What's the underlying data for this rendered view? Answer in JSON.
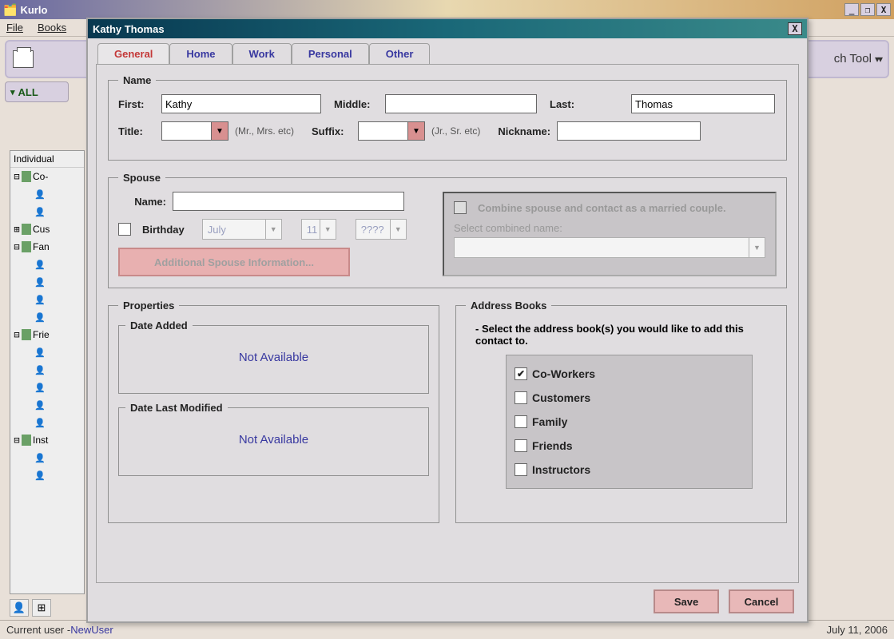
{
  "app": {
    "title": "Kurlo",
    "menu": {
      "file": "File",
      "books": "Books"
    },
    "toolbarRight": "ch Tool",
    "allFilter": "ALL",
    "treeHeader": "Individual",
    "treeGroups": [
      "Co-",
      "Cus",
      "Fan",
      "Frie",
      "Inst"
    ]
  },
  "status": {
    "label": "Current user - ",
    "user": "NewUser",
    "date": "July 11, 2006"
  },
  "dialog": {
    "title": "Kathy Thomas",
    "tabs": {
      "general": "General",
      "home": "Home",
      "work": "Work",
      "personal": "Personal",
      "other": "Other"
    },
    "name": {
      "legend": "Name",
      "firstLbl": "First:",
      "first": "Kathy",
      "middleLbl": "Middle:",
      "middle": "",
      "lastLbl": "Last:",
      "last": "Thomas",
      "titleLbl": "Title:",
      "titleHint": "(Mr., Mrs. etc)",
      "suffixLbl": "Suffix:",
      "suffixHint": "(Jr., Sr. etc)",
      "nickLbl": "Nickname:",
      "nick": ""
    },
    "spouse": {
      "legend": "Spouse",
      "nameLbl": "Name:",
      "name": "",
      "birthdayLbl": "Birthday",
      "month": "July",
      "day": "11",
      "year": "????",
      "addlBtn": "Additional Spouse Information...",
      "combineLbl": "Combine spouse and contact as a married couple.",
      "selectCombined": "Select combined name:"
    },
    "props": {
      "legend": "Properties",
      "dateAdded": "Date Added",
      "dateAddedVal": "Not Available",
      "dateMod": "Date Last Modified",
      "dateModVal": "Not Available"
    },
    "ab": {
      "legend": "Address Books",
      "instr": "- Select the address book(s) you would like to add this contact to.",
      "items": [
        {
          "label": "Co-Workers",
          "checked": true
        },
        {
          "label": "Customers",
          "checked": false
        },
        {
          "label": "Family",
          "checked": false
        },
        {
          "label": "Friends",
          "checked": false
        },
        {
          "label": "Instructors",
          "checked": false
        }
      ]
    },
    "buttons": {
      "save": "Save",
      "cancel": "Cancel"
    }
  }
}
